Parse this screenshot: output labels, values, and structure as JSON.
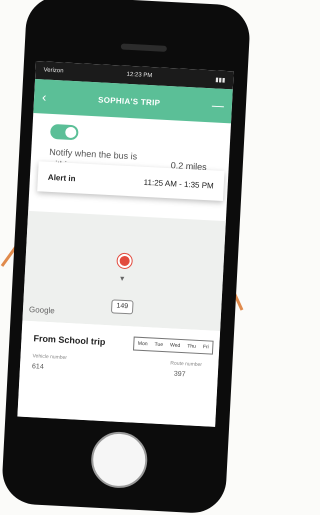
{
  "status_bar": {
    "carrier": "Verizon",
    "time": "12:23 PM",
    "battery": "",
    "signal_icon": "signal-icon",
    "wifi_icon": "wifi-icon"
  },
  "header": {
    "title": "SOPHIA'S TRIP",
    "back_icon": "chevron-left-icon",
    "menu_icon": "more-icon"
  },
  "notify": {
    "enabled": true,
    "label": "Notify when the bus is within",
    "distance": "0.2 miles",
    "slider_level": 0.0
  },
  "alert": {
    "label": "Alert in",
    "window": "11:25 AM - 1:35 PM"
  },
  "map": {
    "logo": "Google",
    "road_number": "149",
    "marker_color": "#e24b3e"
  },
  "trip": {
    "name": "From School trip",
    "days": [
      "Mon",
      "Tue",
      "Wed",
      "Thu",
      "Fri"
    ],
    "vehicle_label": "Vehicle number",
    "vehicle_value": "614",
    "route_label": "Route number",
    "route_value": "397"
  },
  "colors": {
    "accent": "#5bbf97",
    "arrow": "#e08a4c",
    "alert_marker": "#e24b3e"
  }
}
